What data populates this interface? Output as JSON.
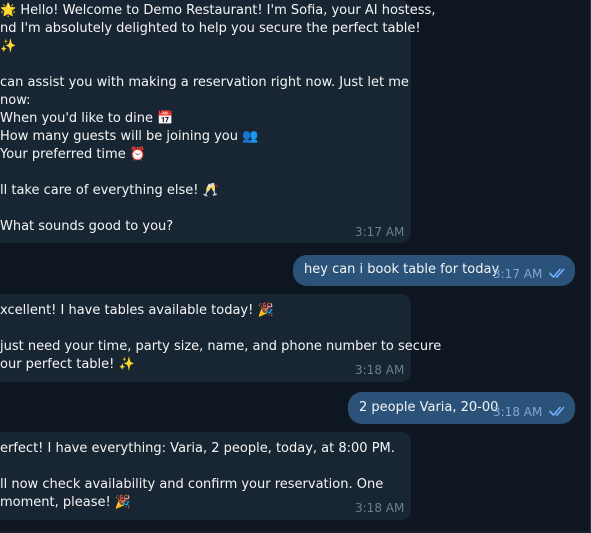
{
  "messages": [
    {
      "direction": "in",
      "lines": [
        "🌟 Hello! Welcome to Demo Restaurant! I'm Sofia, your AI hostess,",
        "nd I'm absolutely delighted to help you secure the perfect table!",
        "✨",
        "",
        "can assist you with making a reservation right now. Just let me",
        "now:",
        "When you'd like to dine 📅",
        "How many guests will be joining you 👥",
        "Your preferred time ⏰",
        "",
        "ll take care of everything else! 🥂",
        "",
        "What sounds good to you?"
      ],
      "time": "3:17 AM"
    },
    {
      "direction": "out",
      "text": "hey can i book table for today",
      "time": "3:17 AM"
    },
    {
      "direction": "in",
      "lines": [
        "xcellent! I have tables available today! 🎉",
        "",
        "just need your time, party size, name, and phone number to secure",
        "our perfect table! ✨"
      ],
      "time": "3:18 AM"
    },
    {
      "direction": "out",
      "text": "2 people Varia, 20-00",
      "time": "3:18 AM"
    },
    {
      "direction": "in",
      "lines": [
        "erfect! I have everything: Varia, 2 people, today, at 8:00 PM.",
        "",
        "ll now check availability and confirm your reservation. One",
        "moment, please! 🎉"
      ],
      "time": "3:18 AM"
    }
  ]
}
